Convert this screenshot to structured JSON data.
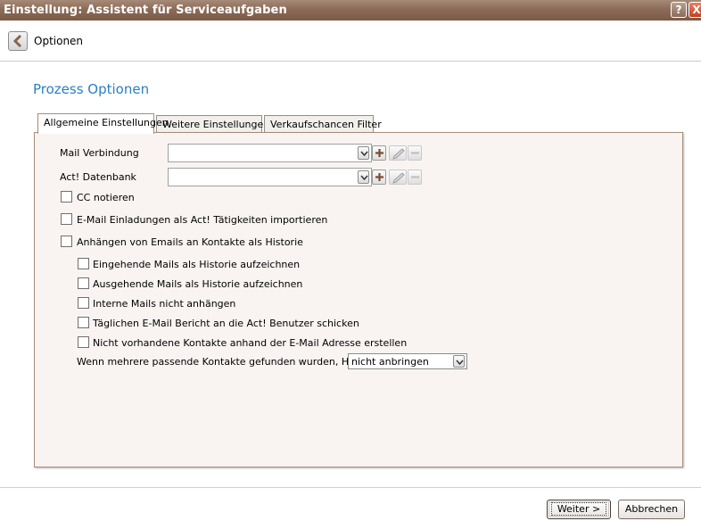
{
  "window": {
    "title": "Einstellung: Assistent für Serviceaufgaben",
    "help_label": "?",
    "close_label": "X"
  },
  "header": {
    "label": "Optionen"
  },
  "page": {
    "title": "Prozess Optionen"
  },
  "tabs": [
    {
      "label": "Allgemeine Einstellungen",
      "active": true
    },
    {
      "label": "Weitere Einstellungen",
      "active": false
    },
    {
      "label": "Verkaufschancen Filter",
      "active": false
    }
  ],
  "fields": {
    "mail": {
      "label": "Mail Verbindung",
      "value": ""
    },
    "db": {
      "label": "Act! Datenbank",
      "value": ""
    }
  },
  "checkboxes": [
    {
      "label": "CC notieren",
      "checked": false
    },
    {
      "label": "E-Mail Einladungen als Act! Tätigkeiten importieren",
      "checked": false
    },
    {
      "label": "Anhängen von Emails an Kontakte als Historie",
      "checked": false
    },
    {
      "label": "Eingehende Mails als Historie aufzeichnen",
      "checked": false
    },
    {
      "label": "Ausgehende Mails als Historie aufzeichnen",
      "checked": false
    },
    {
      "label": "Interne Mails nicht anhängen",
      "checked": false
    },
    {
      "label": "Täglichen E-Mail Bericht an die Act! Benutzer schicken",
      "checked": false
    },
    {
      "label": "Nicht vorhandene Kontakte anhand der E-Mail Adresse erstellen",
      "checked": false
    }
  ],
  "history": {
    "label": "Wenn mehrere passende Kontakte gefunden wurden, Historie",
    "value": "nicht anbringen"
  },
  "footer": {
    "next": "Weiter >",
    "cancel": "Abbrechen"
  },
  "icons": {
    "back": "chevron-left-icon",
    "dropdown": "chevron-down-icon",
    "add": "plus-icon",
    "edit": "pencil-icon",
    "remove": "minus-icon",
    "help": "question-icon",
    "close": "close-icon"
  }
}
